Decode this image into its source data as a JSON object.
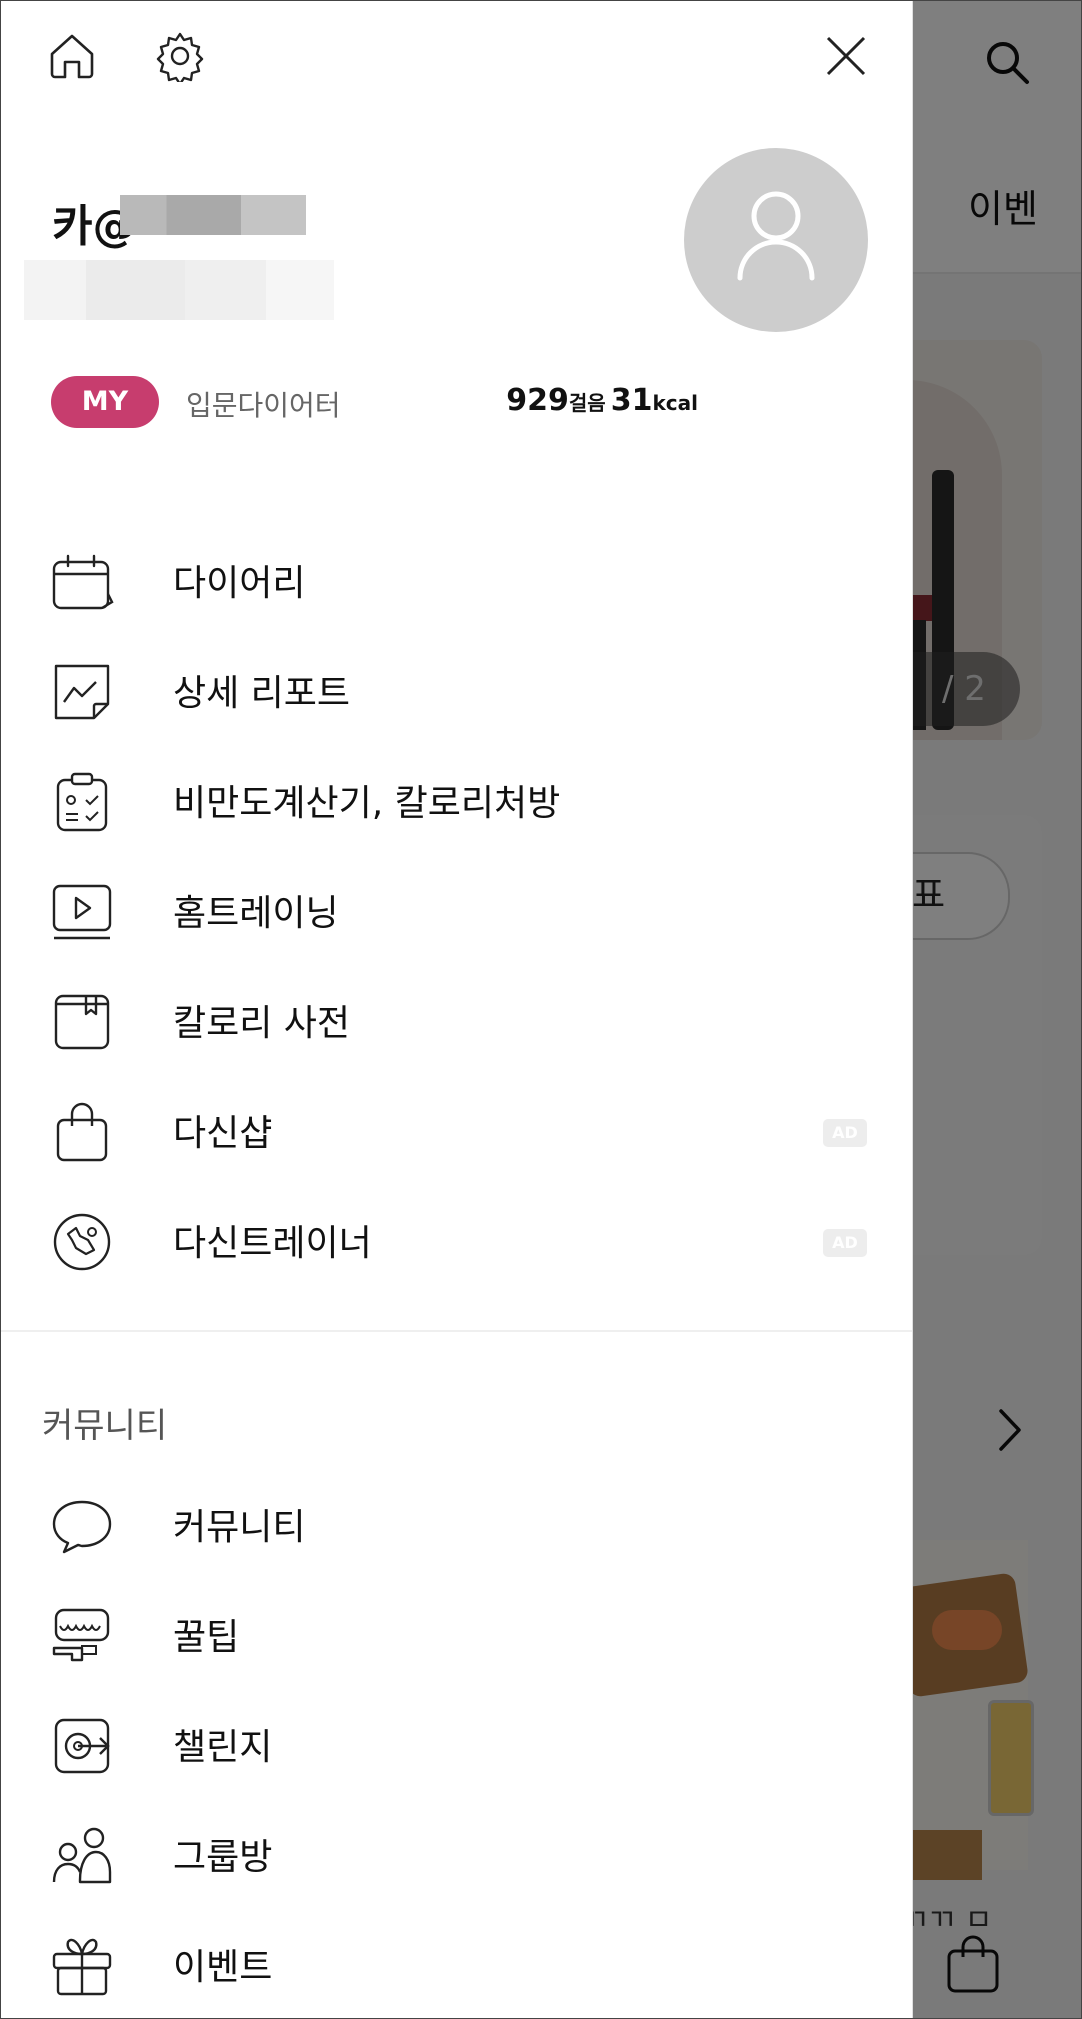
{
  "background": {
    "tab_partial": "이벤",
    "pager_text": "/ 2",
    "pill_partial": "표",
    "bottom_partial": "ㄲㄲ ㅁ"
  },
  "drawer": {
    "header": {
      "home_icon": "home-icon",
      "settings_icon": "gear-icon",
      "close_icon": "close-icon"
    },
    "profile": {
      "name_prefix": "카@",
      "avatar_icon": "person-icon",
      "my_badge": "MY",
      "level": "입문다이어터",
      "steps_value": "929",
      "steps_unit": "걸음",
      "kcal_value": "31",
      "kcal_unit": "kcal"
    },
    "menu": [
      {
        "label": "다이어리",
        "icon": "calendar-icon",
        "ad": ""
      },
      {
        "label": "상세 리포트",
        "icon": "report-chart-icon",
        "ad": ""
      },
      {
        "label": "비만도계산기, 칼로리처방",
        "icon": "clipboard-checklist-icon",
        "ad": ""
      },
      {
        "label": "홈트레이닝",
        "icon": "video-play-icon",
        "ad": ""
      },
      {
        "label": "칼로리 사전",
        "icon": "bookmark-book-icon",
        "ad": ""
      },
      {
        "label": "다신샵",
        "icon": "shopping-bag-icon",
        "ad": "AD"
      },
      {
        "label": "다신트레이너",
        "icon": "trainer-badge-icon",
        "ad": "AD"
      }
    ],
    "community_section": {
      "title": "커뮤니티",
      "items": [
        {
          "label": "커뮤니티",
          "icon": "speech-bubble-icon"
        },
        {
          "label": "꿀팁",
          "icon": "honey-tip-icon"
        },
        {
          "label": "챌린지",
          "icon": "target-arrow-icon"
        },
        {
          "label": "그룹방",
          "icon": "group-people-icon"
        },
        {
          "label": "이벤트",
          "icon": "gift-box-icon"
        }
      ]
    }
  },
  "colors": {
    "accent": "#c73d6e",
    "text": "#111111",
    "muted": "#666666",
    "overlay": "rgba(0,0,0,0.5)"
  }
}
